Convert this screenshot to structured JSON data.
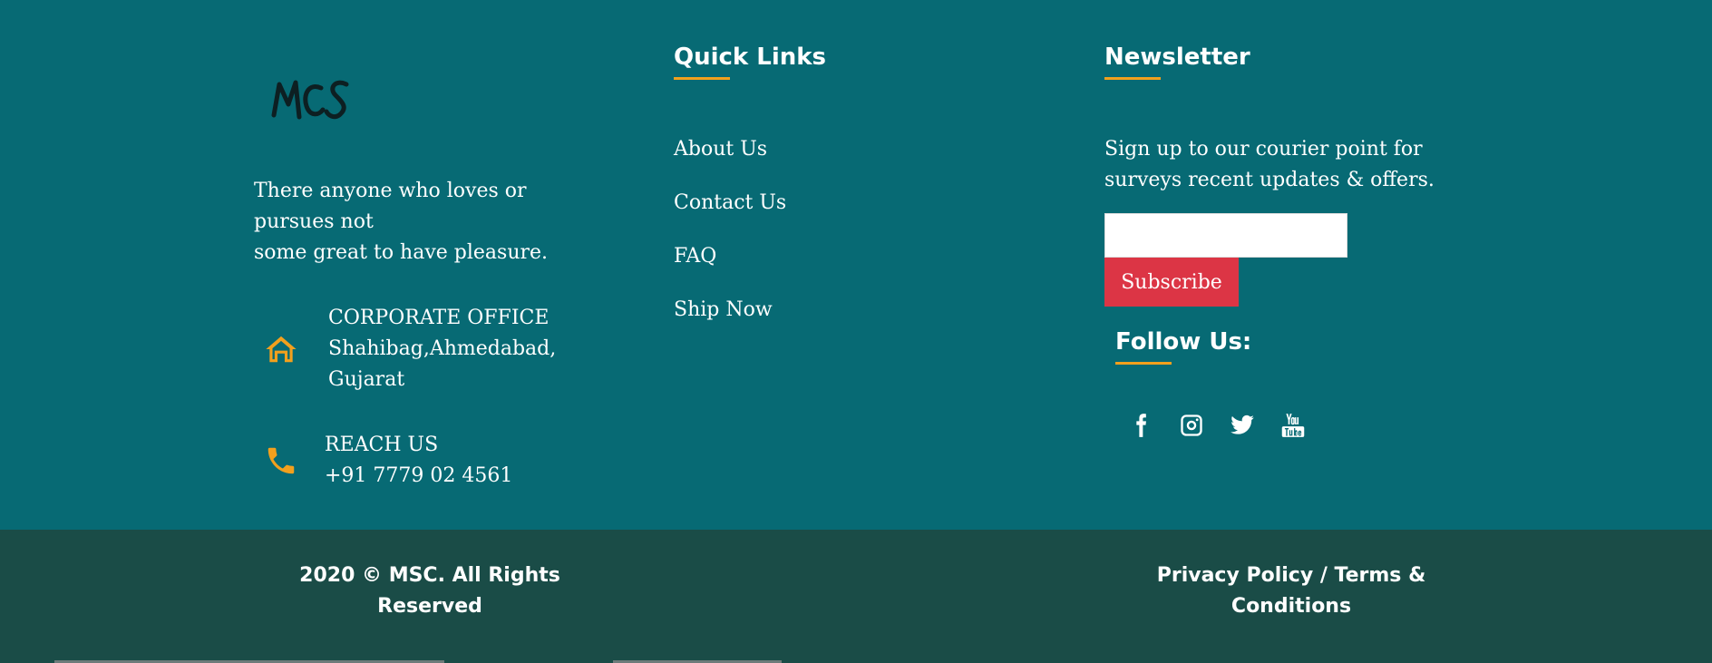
{
  "brand": {
    "logo_text": "MCS",
    "about_lines": [
      "There anyone who loves or",
      "pursues not",
      "some great to have pleasure."
    ]
  },
  "contact": {
    "office": {
      "icon": "home-icon",
      "title": "CORPORATE OFFICE",
      "line1": "Shahibag,Ahmedabad,",
      "line2": "Gujarat"
    },
    "reach": {
      "icon": "phone-icon",
      "title": "REACH US",
      "phone": "+91 7779 02 4561"
    }
  },
  "quick_links": {
    "heading": "Quick Links",
    "items": [
      {
        "label": "About Us"
      },
      {
        "label": "Contact Us"
      },
      {
        "label": "FAQ"
      },
      {
        "label": "Ship Now"
      }
    ]
  },
  "newsletter": {
    "heading": "Newsletter",
    "text_lines": [
      "Sign up to our courier point for",
      "surveys recent updates & offers."
    ],
    "email_value": "",
    "subscribe_label": "Subscribe"
  },
  "follow": {
    "heading": "Follow Us:",
    "icons": [
      "facebook-icon",
      "instagram-icon",
      "twitter-icon",
      "youtube-icon"
    ]
  },
  "bottom_bar": {
    "copyright_line1": "2020 © MSC. All Rights",
    "copyright_line2": "Reserved",
    "legal_line1": "Privacy Policy / Terms &",
    "legal_line2": "Conditions"
  },
  "colors": {
    "main_bg": "#076a74",
    "bottom_bg": "#1a4c47",
    "accent": "#f2a01d",
    "subscribe_bg": "#dc3545"
  }
}
